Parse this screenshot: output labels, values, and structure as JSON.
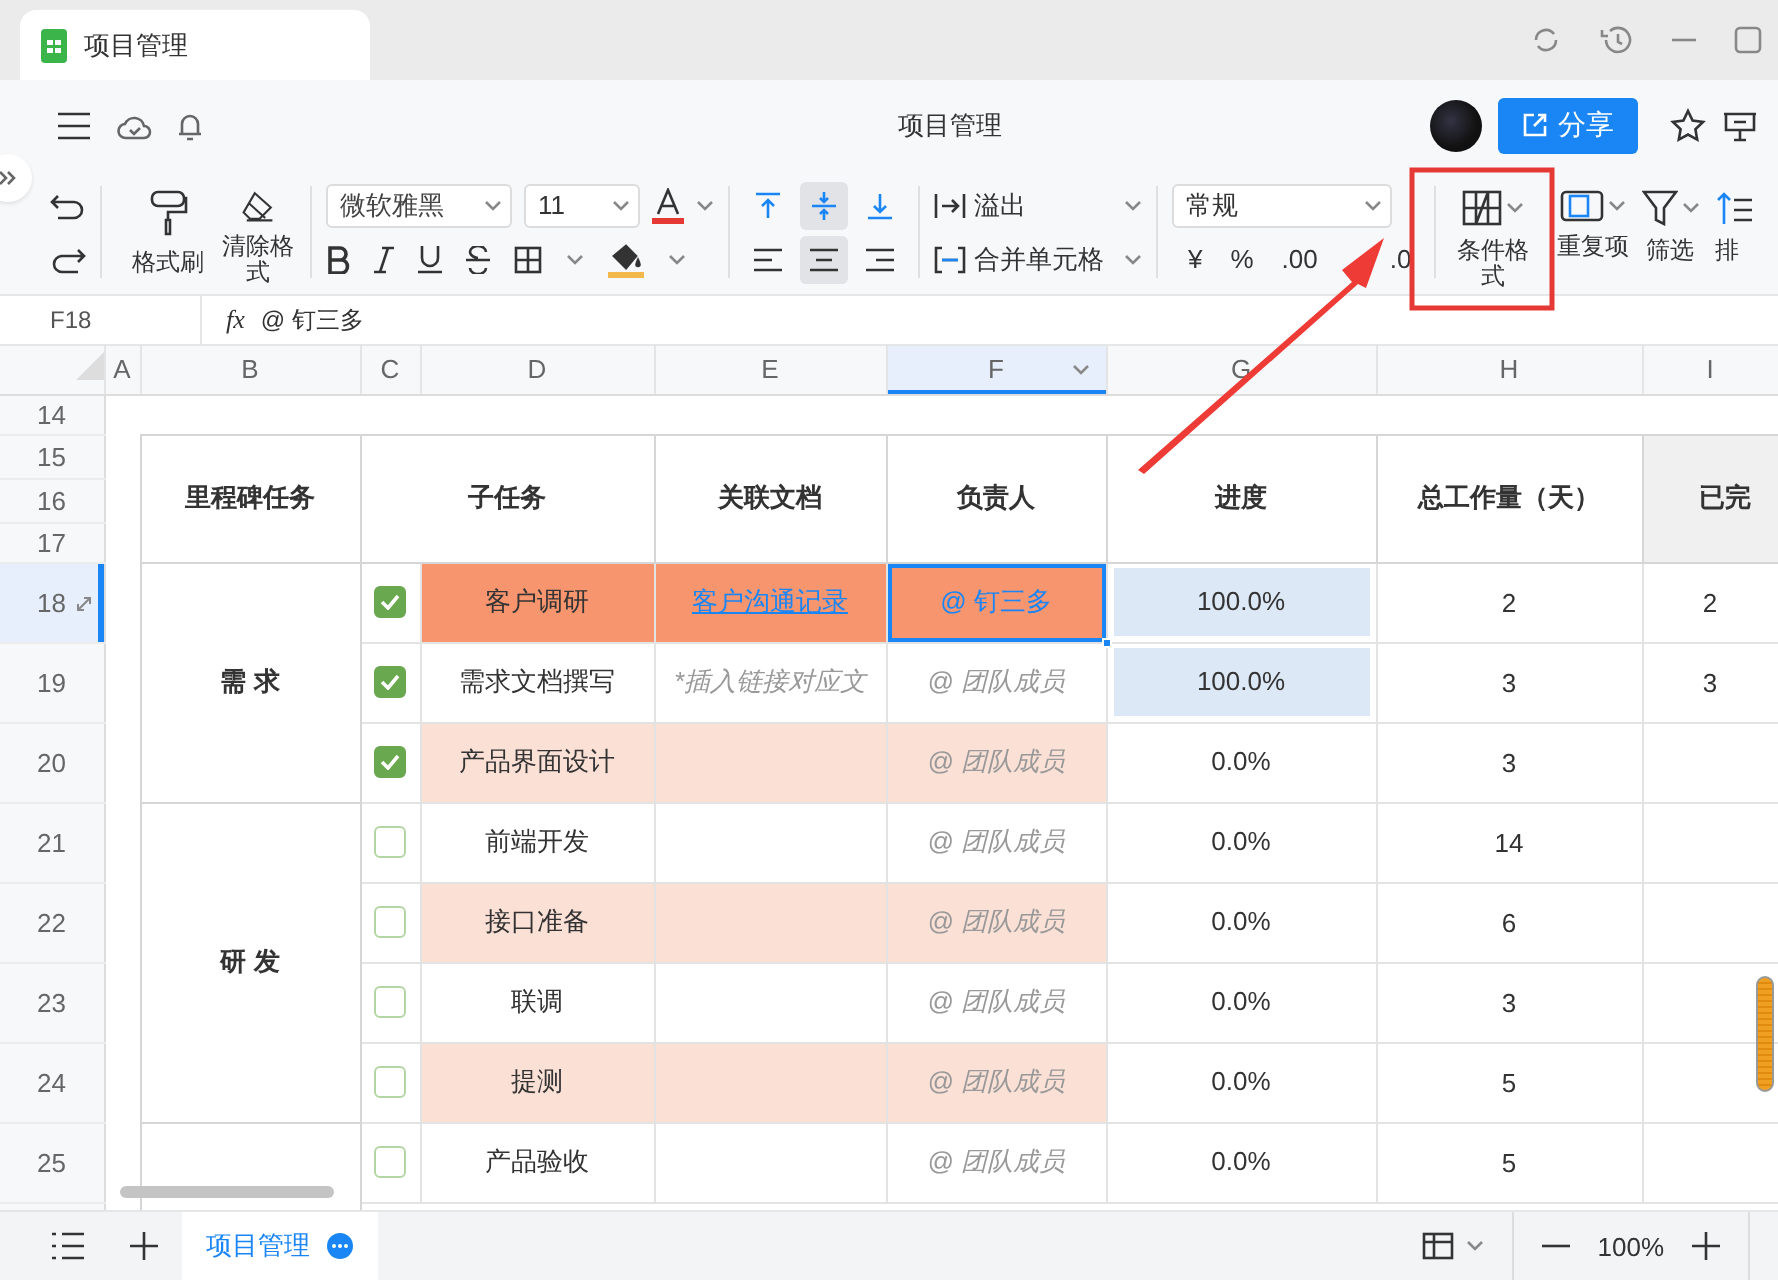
{
  "browser_tab": {
    "title": "项目管理"
  },
  "header": {
    "title": "项目管理",
    "share_button": "分享"
  },
  "toolbar": {
    "format_painter": "格式刷",
    "clear_format": "清除格式",
    "font": "微软雅黑",
    "font_size": "11",
    "overflow": "溢出",
    "merge_cells": "合并单元格",
    "number_format": "常规",
    "currency": "¥",
    "percent": "%",
    "decimal_add": ".00",
    "decimal_remove": ".0",
    "conditional_format": "条件格式",
    "duplicates": "重复项",
    "filter": "筛选",
    "sort": "排",
    "vertical_align": [
      {
        "kind": "top",
        "selected": false
      },
      {
        "kind": "middle",
        "selected": true
      },
      {
        "kind": "bottom",
        "selected": false
      }
    ],
    "horizontal_align": [
      {
        "kind": "left",
        "selected": false
      },
      {
        "kind": "center",
        "selected": true
      },
      {
        "kind": "right",
        "selected": false
      }
    ]
  },
  "formula_bar": {
    "cell": "F18",
    "fx": "fx",
    "value": "@ 钉三多"
  },
  "sheet": {
    "columns": [
      {
        "label": "A",
        "selected": false
      },
      {
        "label": "B",
        "selected": false
      },
      {
        "label": "C",
        "selected": false
      },
      {
        "label": "D",
        "selected": false
      },
      {
        "label": "E",
        "selected": false
      },
      {
        "label": "F",
        "selected": true
      },
      {
        "label": "G",
        "selected": false
      },
      {
        "label": "H",
        "selected": false
      },
      {
        "label": "I",
        "selected": false
      }
    ],
    "row_numbers": [
      {
        "label": "14",
        "selected": false
      },
      {
        "label": "15",
        "selected": false
      },
      {
        "label": "16",
        "selected": false
      },
      {
        "label": "17",
        "selected": false
      },
      {
        "label": "18",
        "selected": true
      },
      {
        "label": "19",
        "selected": false
      },
      {
        "label": "20",
        "selected": false
      },
      {
        "label": "21",
        "selected": false
      },
      {
        "label": "22",
        "selected": false
      },
      {
        "label": "23",
        "selected": false
      },
      {
        "label": "24",
        "selected": false
      },
      {
        "label": "25",
        "selected": false
      }
    ],
    "headers": [
      "里程碑任务",
      "子任务",
      "关联文档",
      "负责人",
      "进度",
      "总工作量（天）",
      "已完"
    ],
    "milestones": [
      {
        "name": "需 求",
        "tasks": [
          {
            "done": true,
            "name": "客户调研",
            "doc": {
              "text": "客户沟通记录",
              "kind": "link"
            },
            "owner": {
              "text": "@ 钉三多",
              "kind": "mention"
            },
            "progress": "100.0%",
            "complete": true,
            "total": "2",
            "finished": "2",
            "color": "#f7956f",
            "selected": true
          },
          {
            "done": true,
            "name": "需求文档撰写",
            "doc": {
              "text": "*插入链接对应文",
              "kind": "placeholder"
            },
            "owner": {
              "text": "@ 团队成员",
              "kind": "placeholder"
            },
            "progress": "100.0%",
            "complete": true,
            "total": "3",
            "finished": "3",
            "color": "#ffffff",
            "selected": false
          },
          {
            "done": true,
            "name": "产品界面设计",
            "owner": {
              "text": "@ 团队成员",
              "kind": "placeholder"
            },
            "progress": "0.0%",
            "complete": false,
            "total": "3",
            "color": "#fbe0d6",
            "selected": false
          }
        ]
      },
      {
        "name": "研 发",
        "tasks": [
          {
            "done": false,
            "name": "前端开发",
            "owner": {
              "text": "@ 团队成员",
              "kind": "placeholder"
            },
            "progress": "0.0%",
            "complete": false,
            "total": "14",
            "color": "#ffffff",
            "selected": false
          },
          {
            "done": false,
            "name": "接口准备",
            "owner": {
              "text": "@ 团队成员",
              "kind": "placeholder"
            },
            "progress": "0.0%",
            "complete": false,
            "total": "6",
            "color": "#fbe0d6",
            "selected": false
          },
          {
            "done": false,
            "name": "联调",
            "owner": {
              "text": "@ 团队成员",
              "kind": "placeholder"
            },
            "progress": "0.0%",
            "complete": false,
            "total": "3",
            "color": "#ffffff",
            "selected": false
          },
          {
            "done": false,
            "name": "提测",
            "owner": {
              "text": "@ 团队成员",
              "kind": "placeholder"
            },
            "progress": "0.0%",
            "complete": false,
            "total": "5",
            "color": "#fbe0d6",
            "selected": false
          }
        ]
      },
      {
        "tasks": [
          {
            "done": false,
            "name": "产品验收",
            "owner": {
              "text": "@ 团队成员",
              "kind": "placeholder"
            },
            "progress": "0.0%",
            "complete": false,
            "total": "5",
            "color": "#ffffff",
            "selected": false
          }
        ]
      }
    ]
  },
  "sheet_tabs": [
    {
      "label": "项目管理",
      "selected": true
    }
  ],
  "zoom": "100%"
}
